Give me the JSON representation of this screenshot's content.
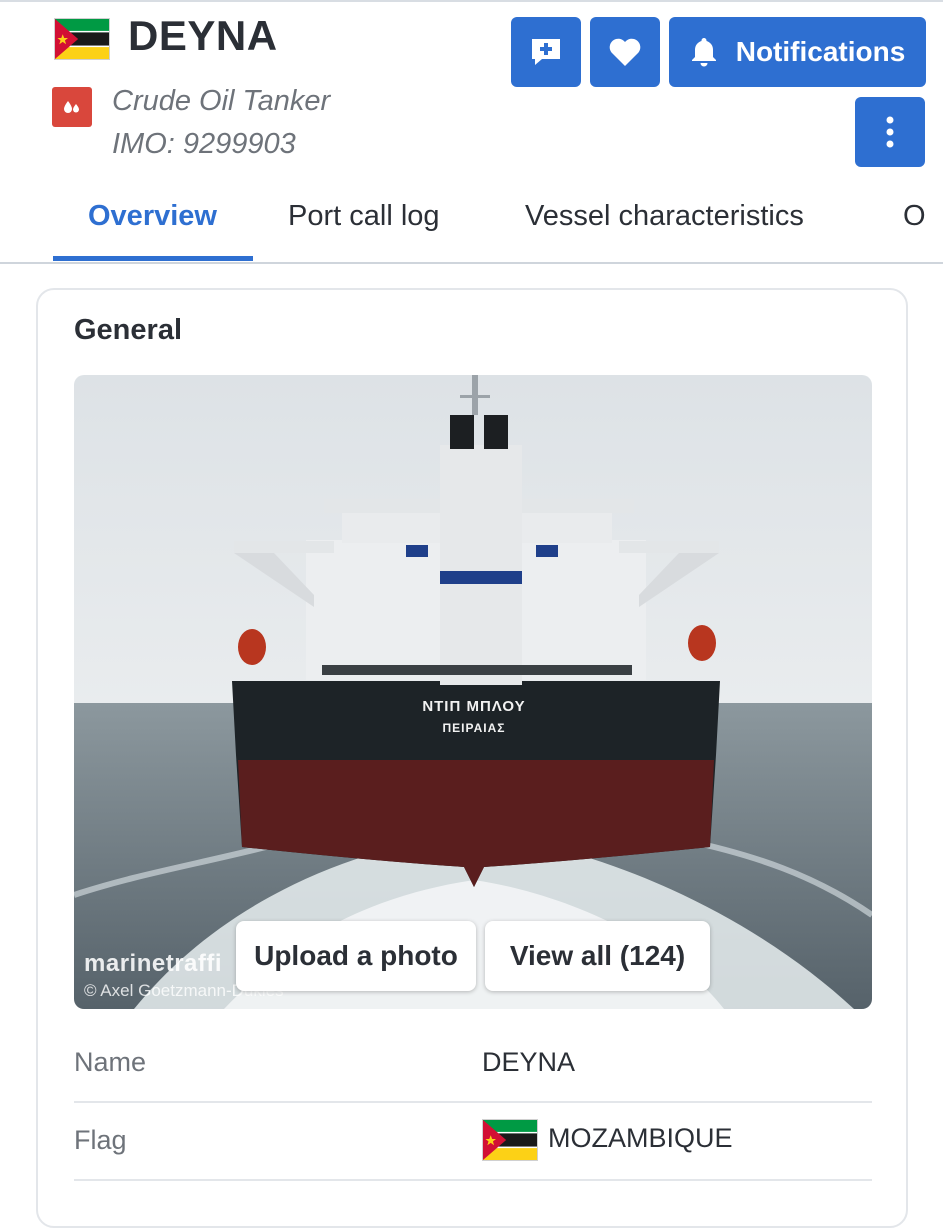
{
  "header": {
    "name": "DEYNA",
    "vessel_type": "Crude Oil Tanker",
    "imo": "IMO: 9299903",
    "flag_icon": "mozambique-flag-icon",
    "type_icon": "oil-drops-icon"
  },
  "actions": {
    "add_icon": "add-to-fleet-icon",
    "favorite_icon": "heart-icon",
    "notifications_label": "Notifications",
    "notifications_icon": "bell-icon",
    "more_icon": "vertical-dots-icon"
  },
  "tabs": [
    {
      "label": "Overview",
      "active": true
    },
    {
      "label": "Port call log",
      "active": false
    },
    {
      "label": "Vessel characteristics",
      "active": false
    },
    {
      "label": "O",
      "active": false
    }
  ],
  "general": {
    "title": "General",
    "photo": {
      "stern_name": "ΝΤΙΠ ΜΠΛΟΥ",
      "stern_port": "ΠΕΙΡΑΙΑΣ",
      "watermark": "marinetraffi",
      "credit": "© Axel Goetzmann-Dukies",
      "upload_label": "Upload a photo",
      "view_all_label": "View all (124)"
    },
    "fields": [
      {
        "label": "Name",
        "value": "DEYNA"
      },
      {
        "label": "Flag",
        "value": "MOZAMBIQUE"
      }
    ]
  },
  "colors": {
    "accent": "#2e6fd1",
    "tanker_icon": "#d9473c"
  }
}
